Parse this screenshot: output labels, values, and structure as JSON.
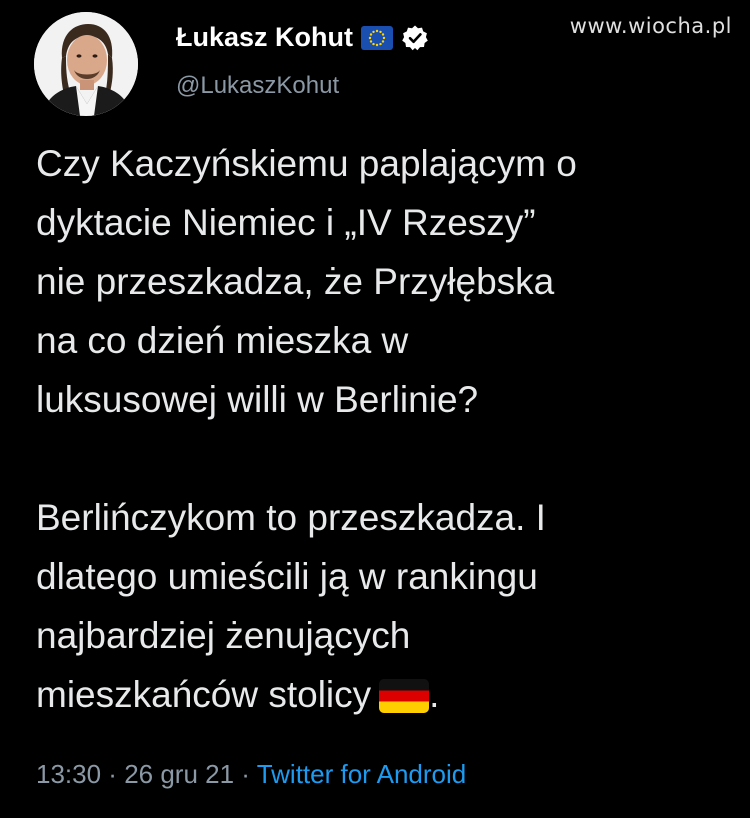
{
  "watermark": "www.wiocha.pl",
  "author": {
    "name": "Łukasz Kohut",
    "handle": "@LukaszKohut",
    "badges": [
      "eu-flag-icon",
      "verified-icon"
    ]
  },
  "tweet": {
    "paragraph1": [
      "Czy Kaczyńskiemu paplającym o",
      "dyktacie Niemiec i „IV Rzeszy”",
      "nie przeszkadza, że Przyłębska",
      "na co dzień mieszka w",
      "luksusowej willi w Berlinie?"
    ],
    "paragraph2": [
      "Berlińczykom to przeszkadza. I",
      "dlatego umieścili ją w rankingu",
      "najbardziej żenujących",
      "mieszkańców stolicy"
    ],
    "trailing_punct": ".",
    "emoji": "germany-flag-icon"
  },
  "meta": {
    "time": "13:30",
    "sep1": " · ",
    "date": "26 gru 21",
    "sep2": " · ",
    "source": "Twitter for Android"
  },
  "colors": {
    "background": "#000000",
    "text": "#e7e9ea",
    "secondary": "#8b98a5",
    "link": "#1d9bf0"
  }
}
